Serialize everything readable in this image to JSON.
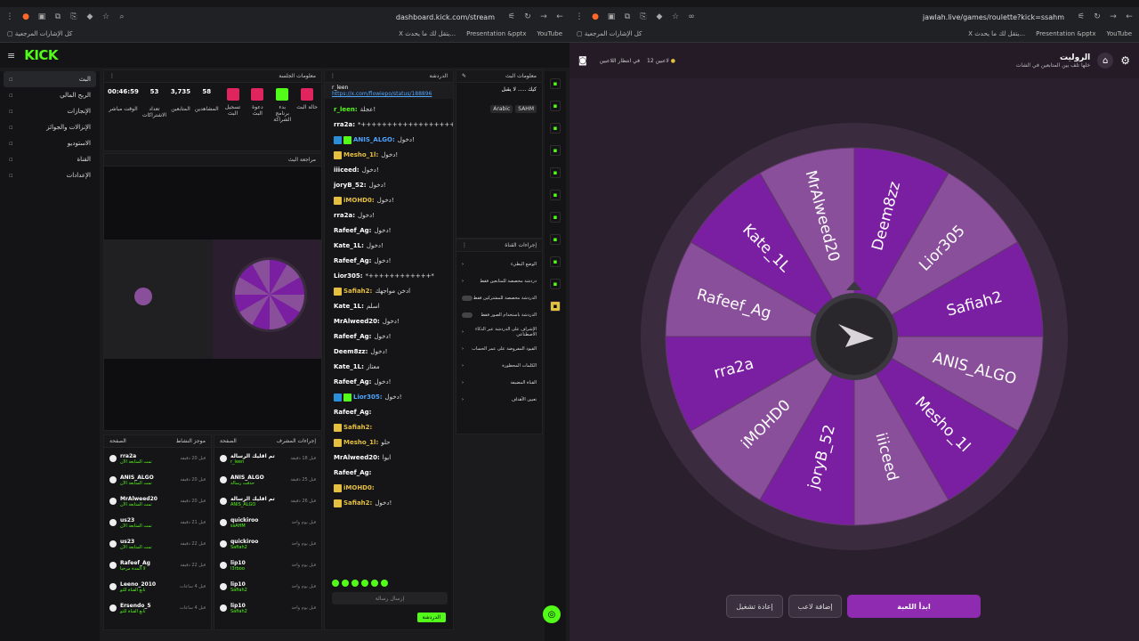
{
  "left_browser": {
    "url": "dashboard.kick.com/stream",
    "bookmarks": {
      "all": "كل الإشارات المرجعية",
      "b1": "X يتقل لك ما يحدث...",
      "b2": "Presentation &pptx",
      "b3": "YouTube"
    }
  },
  "right_browser": {
    "url": "jawlah.live/games/roulette?kick=ssahm",
    "bookmarks": {
      "all": "كل الإشارات المرجعية",
      "b1": "X يتقل لك ما يحدث...",
      "b2": "Presentation &pptx",
      "b3": "YouTube"
    }
  },
  "kick": {
    "logo": "KICK",
    "sidebar": [
      {
        "label": "البث",
        "icon": "live-icon"
      },
      {
        "label": "الربح المالي",
        "icon": "money-icon"
      },
      {
        "label": "الإنجازات",
        "icon": "trophy-icon"
      },
      {
        "label": "الإنزالات والجوائز",
        "icon": "gift-icon"
      },
      {
        "label": "الاستوديو",
        "icon": "studio-icon"
      },
      {
        "label": "القناة",
        "icon": "channel-icon"
      },
      {
        "label": "الإعدادات",
        "icon": "settings-icon"
      }
    ],
    "session": {
      "title": "معلومات الجلسة",
      "stats": [
        {
          "value": "00:46:59",
          "label": "الوقت مباشر"
        },
        {
          "value": "53",
          "label": "تعداد الاشتراكات"
        },
        {
          "value": "3,735",
          "label": "المتابعين"
        },
        {
          "value": "58",
          "label": "المشاهدين"
        }
      ],
      "quick": [
        {
          "label": "تسجيل البث",
          "color": "#e0245e"
        },
        {
          "label": "دعوة البث",
          "color": "#e0245e"
        },
        {
          "label": "بدء برنامج الشراكة",
          "color": "#53fc18"
        },
        {
          "label": "حالة البث",
          "color": "#e0245e"
        }
      ]
    },
    "preview_title": "مراجعة البث",
    "chat": {
      "title": "الدردشة",
      "pinned_user": "r_leen",
      "pinned_link": "https://x.com/flowiepo/status/188896",
      "lines": [
        {
          "user": "r_leen:",
          "text": "عجلة!",
          "color": "g"
        },
        {
          "user": "rra2a:",
          "text": "*++++++++++++++++++++*",
          "color": "w"
        },
        {
          "user": "ANIS_ALGO:",
          "text": "دخول!",
          "color": "b"
        },
        {
          "user": "Mesho_1l:",
          "text": "دخول!",
          "color": "y"
        },
        {
          "user": "iiiceed:",
          "text": "دخول!",
          "color": "w"
        },
        {
          "user": "joryB_52:",
          "text": "دخول!",
          "color": "w"
        },
        {
          "user": "iMOHD0:",
          "text": "دخول!",
          "color": "y"
        },
        {
          "user": "rra2a:",
          "text": "دخول!",
          "color": "w"
        },
        {
          "user": "Rafeef_Ag:",
          "text": "دخول!",
          "color": "w"
        },
        {
          "user": "Kate_1L:",
          "text": "دخول!",
          "color": "w"
        },
        {
          "user": "Rafeef_Ag:",
          "text": "دخول!",
          "color": "w"
        },
        {
          "user": "Lior305:",
          "text": "*++++++++++++*",
          "color": "w"
        },
        {
          "user": "Safiah2:",
          "text": "ادخن مواجهك",
          "color": "y"
        },
        {
          "user": "Kate_1L:",
          "text": "اسلم",
          "color": "w"
        },
        {
          "user": "MrAlweed20:",
          "text": "دخول!",
          "color": "w"
        },
        {
          "user": "Rafeef_Ag:",
          "text": "دخول!",
          "color": "w"
        },
        {
          "user": "Deem8zz:",
          "text": "دخول!",
          "color": "w"
        },
        {
          "user": "Kate_1L:",
          "text": "معتاز",
          "color": "w"
        },
        {
          "user": "Rafeef_Ag:",
          "text": "دخول!",
          "color": "w"
        },
        {
          "user": "Lior305:",
          "text": "دخول!",
          "color": "b"
        },
        {
          "user": "Rafeef_Ag:",
          "text": "",
          "color": "w"
        },
        {
          "user": "Safiah2:",
          "text": "",
          "color": "y"
        },
        {
          "user": "Mesho_1l:",
          "text": "حلو",
          "color": "y"
        },
        {
          "user": "MrAlweed20:",
          "text": "ايوا",
          "color": "w"
        },
        {
          "user": "Rafeef_Ag:",
          "text": "",
          "color": "w"
        },
        {
          "user": "iMOHD0:",
          "text": "",
          "color": "y"
        },
        {
          "user": "Safiah2:",
          "text": "دخول!",
          "color": "y"
        }
      ],
      "input_placeholder": "إرسال رسالة",
      "send": "الدردشة"
    },
    "stream_info": {
      "title": "معلومات البث",
      "name": "كيك ..... لا يقبل",
      "tags": [
        "Arabic",
        "SAHM"
      ]
    },
    "channel_actions": {
      "title": "إجراءات القناة",
      "items": [
        "الوضع البطيء",
        "دردشة مخصصة للمتابعين فقط",
        "الدردشة مخصصة للمشتركين فقط",
        "الدردشة باستخدام الصور فقط",
        "الإشراف على الدردشة عبر الذكاء الاصطناعي",
        "القيود المفروضة على عمر الحساب",
        "الكلمات المحظورة",
        "القناة المضيفة",
        "تعيين الأهداف"
      ]
    },
    "activity": {
      "title": "موجز النشاط",
      "tab": "الصفحة",
      "rows": [
        {
          "user": "rra2a",
          "sub": "تمت المتابعة الآن",
          "time": "قبل 20 دقيقة"
        },
        {
          "user": "ANIS_ALGO",
          "sub": "تمت المتابعة الآن",
          "time": "قبل 20 دقيقة"
        },
        {
          "user": "MrAlweed20",
          "sub": "تمت المتابعة الآن",
          "time": "قبل 20 دقيقة"
        },
        {
          "user": "us23",
          "sub": "تمت المتابعة الآن",
          "time": "قبل 21 دقيقة"
        },
        {
          "user": "us23",
          "sub": "تمت المتابعة الآن",
          "time": "قبل 22 دقيقة"
        },
        {
          "user": "Rafeef_Ag",
          "sub": "لا المدة مرحبا",
          "time": "قبل 22 دقيقة"
        },
        {
          "user": "Leeno_2010",
          "sub": "تابع القناة للتو",
          "time": "قبل 4 ساعات"
        },
        {
          "user": "Ersendo_5",
          "sub": "تابع القناة للتو",
          "time": "قبل 4 ساعات"
        }
      ]
    },
    "mod_actions": {
      "title": "إجراءات المشرف",
      "tab": "الصفحة",
      "rows": [
        {
          "user": "تم اقليك الرسالة",
          "sub": "r_leen",
          "time": "قبل 18 دقيقة"
        },
        {
          "user": "ANIS_ALGO",
          "sub": "حذفت رسالة",
          "time": "قبل 25 دقيقة"
        },
        {
          "user": "تم اقليك الرسالة",
          "sub": "ANIS_ALGO",
          "time": "قبل 26 دقيقة"
        },
        {
          "user": "quickiroo",
          "sub": "ssAHM",
          "time": "قبل يوم واحد"
        },
        {
          "user": "quickiroo",
          "sub": "Safiah2",
          "time": "قبل يوم واحد"
        },
        {
          "user": "lip10",
          "sub": "l3rboo",
          "time": "قبل يوم واحد"
        },
        {
          "user": "lip10",
          "sub": "Safiah2",
          "time": "قبل يوم واحد"
        },
        {
          "user": "lip10",
          "sub": "Safiah2",
          "time": "قبل يوم واحد"
        }
      ]
    }
  },
  "roulette": {
    "title": "الروليت",
    "subtitle": "خلها تلف بين المتابعين في الشات",
    "status_waiting": "في انتظار اللاعبين",
    "player_count": "12 لاعبين",
    "segments": [
      "Deem8zz",
      "Lior305",
      "Safiah2",
      "ANIS_ALGO",
      "Mesho_1l",
      "iiiceed",
      "joryB_52",
      "iMOHD0",
      "rra2a",
      "Rafeef_Ag",
      "Kate_1L",
      "MrAlweed20"
    ],
    "colors": {
      "dark": "#7b1fa2",
      "light": "#8a4f9b",
      "rim": "#3a2c3e",
      "start": "#8e2bb0"
    },
    "buttons": {
      "start": "ابدأ اللعبة",
      "add": "إضافة لاعب",
      "restart": "إعادة تشغيل"
    }
  }
}
